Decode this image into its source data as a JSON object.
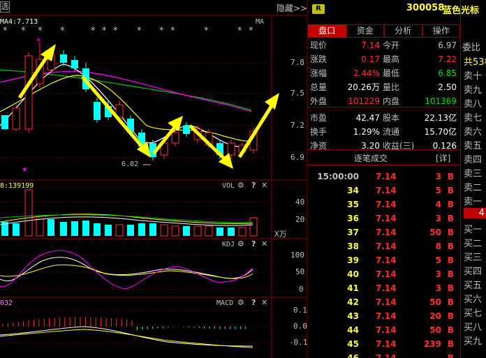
{
  "toolbar": {
    "left_button": "选",
    "hide_label": "隐藏>>",
    "r_badge": "R",
    "stock_code": "300058",
    "stock_name": "蓝色光标"
  },
  "kline": {
    "ma_label": "MA4:7.713",
    "ma_tag": "MA",
    "low_annotation": "6.82",
    "y_ticks": [
      "7.8",
      "7.5",
      "7.2",
      "6.9"
    ]
  },
  "vol_panel": {
    "left_label": "8:139199",
    "name": "VOL",
    "y_ticks": [
      "40",
      "20"
    ],
    "unit": "X万"
  },
  "kdj_panel": {
    "name": "KDJ",
    "y_ticks": [
      "100",
      "50",
      "0"
    ]
  },
  "macd_panel": {
    "left_label": "032",
    "name": "MACD",
    "y_ticks": [
      "0.1",
      "0.0",
      "-0.1"
    ]
  },
  "tabs": [
    {
      "label": "盘口",
      "active": true
    },
    {
      "label": "资金",
      "active": false
    },
    {
      "label": "分析",
      "active": false
    },
    {
      "label": "操作",
      "active": false
    }
  ],
  "quote": [
    {
      "l1": "现价",
      "v1": "7.14",
      "c1": "red",
      "l2": "今开",
      "v2": "6.97",
      "c2": "cl"
    },
    {
      "l1": "涨跌",
      "v1": "0.17",
      "c1": "red",
      "l2": "最高",
      "v2": "7.22",
      "c2": "red"
    },
    {
      "l1": "涨幅",
      "v1": "2.44%",
      "c1": "red",
      "l2": "最低",
      "v2": "6.85",
      "c2": "green"
    },
    {
      "l1": "总量",
      "v1": "20.26万",
      "c1": "wht",
      "l2": "量比",
      "v2": "2.50",
      "c2": "wht"
    },
    {
      "l1": "外盘",
      "v1": "101229",
      "c1": "red",
      "l2": "内盘",
      "v2": "101369",
      "c2": "green"
    },
    {
      "l1": "市盈",
      "v1": "42.47",
      "c1": "wht",
      "l2": "股本",
      "v2": "22.13亿",
      "c2": "wht"
    },
    {
      "l1": "换手",
      "v1": "1.29%",
      "c1": "wht",
      "l2": "流通",
      "v2": "15.70亿",
      "c2": "wht"
    },
    {
      "l1": "净资",
      "v1": "3.20",
      "c1": "wht",
      "l2": "收益(三)",
      "v2": "0.126",
      "c2": "wht"
    }
  ],
  "trades_header": {
    "title": "逐笔成交",
    "detail": "[详]"
  },
  "trades": [
    {
      "time": "15:00:00",
      "price": "7.14",
      "vol": "3",
      "side": "B"
    },
    {
      "time": "34",
      "price": "7.14",
      "vol": "5",
      "side": "B"
    },
    {
      "time": "35",
      "price": "7.14",
      "vol": "4",
      "side": "B"
    },
    {
      "time": "36",
      "price": "7.14",
      "vol": "3",
      "side": "B"
    },
    {
      "time": "37",
      "price": "7.14",
      "vol": "50",
      "side": "B"
    },
    {
      "time": "38",
      "price": "7.14",
      "vol": "8",
      "side": "B"
    },
    {
      "time": "39",
      "price": "7.14",
      "vol": "5",
      "side": "B"
    },
    {
      "time": "40",
      "price": "7.14",
      "vol": "3",
      "side": "B"
    },
    {
      "time": "41",
      "price": "7.14",
      "vol": "3",
      "side": "B"
    },
    {
      "time": "42",
      "price": "7.14",
      "vol": "50",
      "side": "B"
    },
    {
      "time": "43",
      "price": "7.14",
      "vol": "20",
      "side": "B"
    },
    {
      "time": "44",
      "price": "7.14",
      "vol": "50",
      "side": "B"
    },
    {
      "time": "45",
      "price": "7.14",
      "vol": "239",
      "side": "B"
    },
    {
      "time": "46",
      "price": "7.14",
      "vol": "",
      "side": "B"
    }
  ],
  "side_panel": {
    "header": "委比",
    "items": [
      "卖十",
      "共53档",
      "卖十",
      "卖九",
      "卖八",
      "卖七",
      "卖六",
      "卖五",
      "卖四",
      "卖三",
      "卖二",
      "卖一",
      "4",
      "买一",
      "买二",
      "买三",
      "买四",
      "买五",
      "买六",
      "买七",
      "买八",
      "买九"
    ]
  },
  "colors": {
    "up": "#ff3030",
    "down": "#00ffff",
    "arrow": "#ffff00",
    "ma_white": "#ffffff",
    "ma_yellow": "#ffff00",
    "ma_magenta": "#ff00ff",
    "ma_green": "#00c000",
    "grid": "#800000"
  }
}
